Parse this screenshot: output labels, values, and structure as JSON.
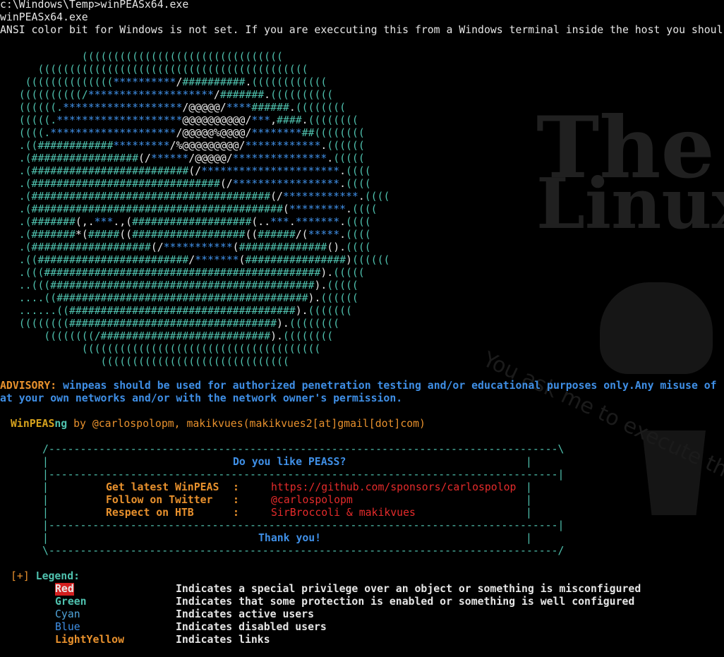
{
  "colors": {
    "background": "#000000",
    "text": "#e6e6e6",
    "cyan": "#4fc1ae",
    "blue": "#3f8fe6",
    "red": "#e52b2b",
    "orange": "#e8912d"
  },
  "watermark": {
    "line1": "The",
    "line2": "LinuxSys",
    "tagline": "You ask me to execute the command. Bu"
  },
  "header": {
    "prompt": "c:\\Windows\\Temp>winPEASx64.exe",
    "echo": "winPEASx64.exe",
    "ansi_warning": "ANSI color bit for Windows is not set. If you are execcuting this from a Windows terminal inside the host you shoul"
  },
  "art_lines": [
    [
      {
        "t": "             ((((((((((((((((((((((((((((((((",
        "c": "cyan"
      }
    ],
    [
      {
        "t": "      (((((((((((((((((((((((((((((((((((((((((((",
        "c": "cyan"
      }
    ],
    [
      {
        "t": "    ((((((((((((((",
        "c": "cyan"
      },
      {
        "t": "**********",
        "c": "blue"
      },
      {
        "t": "/",
        "c": "white"
      },
      {
        "t": "##########",
        "c": "cyan"
      },
      {
        "t": ".",
        "c": "white"
      },
      {
        "t": "((((((((((((",
        "c": "cyan"
      }
    ],
    [
      {
        "t": "   ((((((((((/",
        "c": "cyan"
      },
      {
        "t": "********************",
        "c": "blue"
      },
      {
        "t": "/",
        "c": "white"
      },
      {
        "t": "#######",
        "c": "cyan"
      },
      {
        "t": ".",
        "c": "white"
      },
      {
        "t": "((((((((((",
        "c": "cyan"
      }
    ],
    [
      {
        "t": "   ((((((.",
        "c": "cyan"
      },
      {
        "t": "*******************",
        "c": "blue"
      },
      {
        "t": "/@@@@@/",
        "c": "white"
      },
      {
        "t": "****",
        "c": "blue"
      },
      {
        "t": "######",
        "c": "cyan"
      },
      {
        "t": ".",
        "c": "white"
      },
      {
        "t": "((((((((",
        "c": "cyan"
      }
    ],
    [
      {
        "t": "   (((((.",
        "c": "cyan"
      },
      {
        "t": "********************",
        "c": "blue"
      },
      {
        "t": "@@@@@@@@@@/",
        "c": "white"
      },
      {
        "t": "***",
        "c": "blue"
      },
      {
        "t": ",",
        "c": "white"
      },
      {
        "t": "####",
        "c": "cyan"
      },
      {
        "t": ".",
        "c": "white"
      },
      {
        "t": "((((((((",
        "c": "cyan"
      }
    ],
    [
      {
        "t": "   ((((.",
        "c": "cyan"
      },
      {
        "t": "********************",
        "c": "blue"
      },
      {
        "t": "/@@@@@%@@@@/",
        "c": "white"
      },
      {
        "t": "********",
        "c": "blue"
      },
      {
        "t": "##",
        "c": "cyan"
      },
      {
        "t": "((((((((",
        "c": "cyan"
      }
    ],
    [
      {
        "t": "   .((",
        "c": "cyan"
      },
      {
        "t": "############",
        "c": "cyan"
      },
      {
        "t": "*********",
        "c": "blue"
      },
      {
        "t": "/%@@@@@@@@@/",
        "c": "white"
      },
      {
        "t": "************",
        "c": "blue"
      },
      {
        "t": ".",
        "c": "white"
      },
      {
        "t": "((((((",
        "c": "cyan"
      }
    ],
    [
      {
        "t": "   .(",
        "c": "cyan"
      },
      {
        "t": "#################",
        "c": "cyan"
      },
      {
        "t": "(/",
        "c": "white"
      },
      {
        "t": "******",
        "c": "blue"
      },
      {
        "t": "/@@@@@/",
        "c": "white"
      },
      {
        "t": "***************",
        "c": "blue"
      },
      {
        "t": ".",
        "c": "white"
      },
      {
        "t": "(((((",
        "c": "cyan"
      }
    ],
    [
      {
        "t": "   .(",
        "c": "cyan"
      },
      {
        "t": "#########################",
        "c": "cyan"
      },
      {
        "t": "(/",
        "c": "white"
      },
      {
        "t": "**********************",
        "c": "blue"
      },
      {
        "t": ".",
        "c": "white"
      },
      {
        "t": "((((",
        "c": "cyan"
      }
    ],
    [
      {
        "t": "   .(",
        "c": "cyan"
      },
      {
        "t": "##############################",
        "c": "cyan"
      },
      {
        "t": "(/",
        "c": "white"
      },
      {
        "t": "*****************",
        "c": "blue"
      },
      {
        "t": ".",
        "c": "white"
      },
      {
        "t": "((((",
        "c": "cyan"
      }
    ],
    [
      {
        "t": "   .(",
        "c": "cyan"
      },
      {
        "t": "######################################",
        "c": "cyan"
      },
      {
        "t": "(/",
        "c": "white"
      },
      {
        "t": "************",
        "c": "blue"
      },
      {
        "t": ".",
        "c": "white"
      },
      {
        "t": "((((",
        "c": "cyan"
      }
    ],
    [
      {
        "t": "   .(",
        "c": "cyan"
      },
      {
        "t": "########################################",
        "c": "cyan"
      },
      {
        "t": "(",
        "c": "white"
      },
      {
        "t": "*********",
        "c": "blue"
      },
      {
        "t": ".",
        "c": "white"
      },
      {
        "t": "((((",
        "c": "cyan"
      }
    ],
    [
      {
        "t": "   .(",
        "c": "cyan"
      },
      {
        "t": "#######",
        "c": "cyan"
      },
      {
        "t": "(,.",
        "c": "white"
      },
      {
        "t": "***",
        "c": "blue"
      },
      {
        "t": ".,(",
        "c": "white"
      },
      {
        "t": "###################",
        "c": "cyan"
      },
      {
        "t": "(..",
        "c": "white"
      },
      {
        "t": "***",
        "c": "blue"
      },
      {
        "t": ".",
        "c": "white"
      },
      {
        "t": "*******",
        "c": "blue"
      },
      {
        "t": ".",
        "c": "white"
      },
      {
        "t": "((((",
        "c": "cyan"
      }
    ],
    [
      {
        "t": "   .(",
        "c": "cyan"
      },
      {
        "t": "#######",
        "c": "cyan"
      },
      {
        "t": "*(",
        "c": "white"
      },
      {
        "t": "#####",
        "c": "cyan"
      },
      {
        "t": "((",
        "c": "white"
      },
      {
        "t": "##################",
        "c": "cyan"
      },
      {
        "t": "((",
        "c": "white"
      },
      {
        "t": "######",
        "c": "cyan"
      },
      {
        "t": "/(",
        "c": "white"
      },
      {
        "t": "*****",
        "c": "blue"
      },
      {
        "t": ".",
        "c": "white"
      },
      {
        "t": "((((",
        "c": "cyan"
      }
    ],
    [
      {
        "t": "   .(",
        "c": "cyan"
      },
      {
        "t": "###################",
        "c": "cyan"
      },
      {
        "t": "(/",
        "c": "white"
      },
      {
        "t": "***********",
        "c": "blue"
      },
      {
        "t": "(",
        "c": "white"
      },
      {
        "t": "##############",
        "c": "cyan"
      },
      {
        "t": "().",
        "c": "white"
      },
      {
        "t": "((((",
        "c": "cyan"
      }
    ],
    [
      {
        "t": "   .((",
        "c": "cyan"
      },
      {
        "t": "########################",
        "c": "cyan"
      },
      {
        "t": "/",
        "c": "white"
      },
      {
        "t": "*******",
        "c": "blue"
      },
      {
        "t": "(",
        "c": "white"
      },
      {
        "t": "################",
        "c": "cyan"
      },
      {
        "t": ")",
        "c": "white"
      },
      {
        "t": "((((((",
        "c": "cyan"
      }
    ],
    [
      {
        "t": "   .(((",
        "c": "cyan"
      },
      {
        "t": "############################################",
        "c": "cyan"
      },
      {
        "t": ").",
        "c": "white"
      },
      {
        "t": "(((((",
        "c": "cyan"
      }
    ],
    [
      {
        "t": "   ..(((",
        "c": "cyan"
      },
      {
        "t": "##########################################",
        "c": "cyan"
      },
      {
        "t": ").",
        "c": "white"
      },
      {
        "t": "(((((",
        "c": "cyan"
      }
    ],
    [
      {
        "t": "   ....((",
        "c": "cyan"
      },
      {
        "t": "########################################",
        "c": "cyan"
      },
      {
        "t": ").",
        "c": "white"
      },
      {
        "t": "((((((",
        "c": "cyan"
      }
    ],
    [
      {
        "t": "   ......((",
        "c": "cyan"
      },
      {
        "t": "####################################",
        "c": "cyan"
      },
      {
        "t": ").",
        "c": "white"
      },
      {
        "t": "(((((((",
        "c": "cyan"
      }
    ],
    [
      {
        "t": "   ((((((((",
        "c": "cyan"
      },
      {
        "t": "#################################",
        "c": "cyan"
      },
      {
        "t": ").",
        "c": "white"
      },
      {
        "t": "((((((((",
        "c": "cyan"
      }
    ],
    [
      {
        "t": "       ((((((((/",
        "c": "cyan"
      },
      {
        "t": "###########################",
        "c": "cyan"
      },
      {
        "t": ").",
        "c": "white"
      },
      {
        "t": "((((((((",
        "c": "cyan"
      }
    ],
    [
      {
        "t": "             ((((((((((((((((((((((((((((((((((((((",
        "c": "cyan"
      }
    ],
    [
      {
        "t": "                ((((((((((((((((((((((((((((((",
        "c": "cyan"
      }
    ]
  ],
  "advisory": {
    "label": "ADVISORY:",
    "text1": " winpeas should be used for authorized penetration testing and/or educational purposes only.Any misuse of",
    "text2": "at your own networks and/or with the network owner's permission."
  },
  "credits": {
    "name_a": "WinPEAS",
    "name_b": "ng",
    "rest": " by @carlospolopm, makikvues(makikvues2[at]gmail[dot]com)"
  },
  "box": {
    "border_top": "/---------------------------------------------------------------------------------\\",
    "border_bottom": "\\---------------------------------------------------------------------------------/",
    "divider": "|---------------------------------------------------------------------------------|",
    "title": "Do you like PEASS?",
    "rows": [
      {
        "label": "Get latest WinPEAS",
        "value": "https://github.com/sponsors/carlospolop"
      },
      {
        "label": "Follow on Twitter",
        "value": "@carlospolopm"
      },
      {
        "label": "Respect on HTB",
        "value": "SirBroccoli & makikvues"
      }
    ],
    "separator": ":",
    "thanks": "Thank you!"
  },
  "legend": {
    "title_prefix": "[+]",
    "title": "Legend:",
    "items": [
      {
        "name": "Red",
        "desc": "Indicates a special privilege over an object or something is misconfigured"
      },
      {
        "name": "Green",
        "desc": "Indicates that some protection is enabled or something is well configured"
      },
      {
        "name": "Cyan",
        "desc": "Indicates active users"
      },
      {
        "name": "Blue",
        "desc": "Indicates disabled users"
      },
      {
        "name": "LightYellow",
        "desc": "Indicates links"
      }
    ]
  }
}
